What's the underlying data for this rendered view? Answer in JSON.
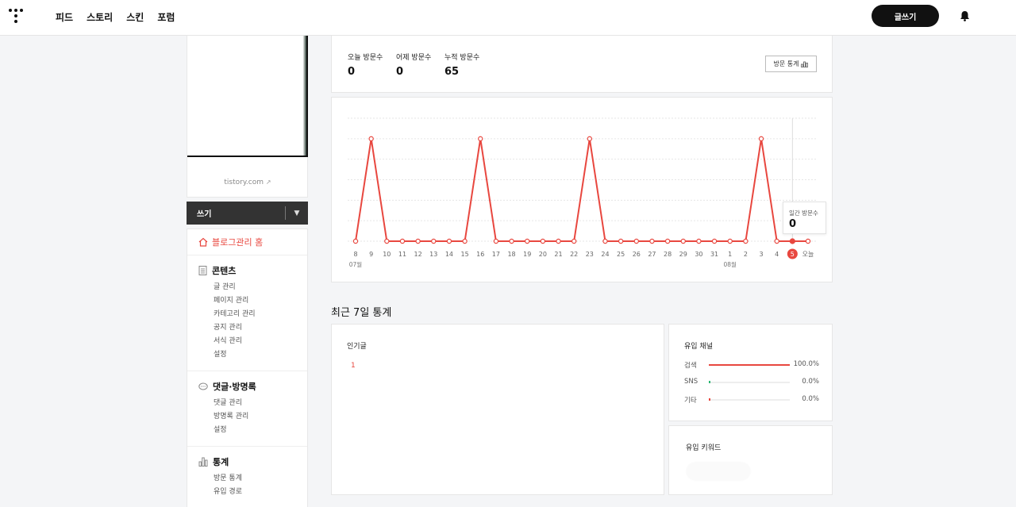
{
  "nav": {
    "items": [
      "피드",
      "스토리",
      "스킨",
      "포럼"
    ],
    "write_button": "글쓰기"
  },
  "sidebar": {
    "blog_url": "tistory.com",
    "write_label": "쓰기",
    "home_label": "블로그관리 홈",
    "groups": [
      {
        "title": "콘텐츠",
        "icon": "document-icon",
        "items": [
          "글 관리",
          "페이지 관리",
          "카테고리 관리",
          "공지 관리",
          "서식 관리",
          "설정"
        ]
      },
      {
        "title": "댓글·방명록",
        "icon": "comment-icon",
        "items": [
          "댓글 관리",
          "방명록 관리",
          "설정"
        ]
      },
      {
        "title": "통계",
        "icon": "bar-chart-icon",
        "items": [
          "방문 통계",
          "유입 경로"
        ]
      }
    ]
  },
  "stats": {
    "today_label": "오늘 방문수",
    "today_value": "0",
    "yesterday_label": "어제 방문수",
    "yesterday_value": "0",
    "total_label": "누적 방문수",
    "total_value": "65",
    "button_label": "방문 통계"
  },
  "chart_data": {
    "type": "line",
    "x": [
      "8",
      "9",
      "10",
      "11",
      "12",
      "13",
      "14",
      "15",
      "16",
      "17",
      "18",
      "19",
      "20",
      "21",
      "22",
      "23",
      "24",
      "25",
      "26",
      "27",
      "28",
      "29",
      "30",
      "31",
      "1",
      "2",
      "3",
      "4",
      "5",
      "오늘"
    ],
    "month_labels": [
      {
        "label": "07월",
        "at": "8"
      },
      {
        "label": "08월",
        "at": "1"
      }
    ],
    "highlight": "5",
    "series": [
      {
        "values": [
          0,
          5,
          0,
          0,
          0,
          0,
          0,
          0,
          5,
          0,
          0,
          0,
          0,
          0,
          0,
          5,
          0,
          0,
          0,
          0,
          0,
          0,
          0,
          0,
          0,
          0,
          5,
          0,
          0,
          0
        ]
      }
    ],
    "ylim": [
      0,
      6
    ],
    "grid": true,
    "color": "#e8473f",
    "tooltip": {
      "label": "일간 방문수",
      "value": "0"
    }
  },
  "recent": {
    "title": "최근 7일 통계",
    "popular_title": "인기글",
    "popular_items": [
      "1"
    ],
    "channel_title": "유입 채널",
    "channels": [
      {
        "name": "검색",
        "pct": "100.0%",
        "value": 100,
        "color": "#e8473f"
      },
      {
        "name": "SNS",
        "pct": "0.0%",
        "value": 0,
        "color": "#2bb673"
      },
      {
        "name": "기타",
        "pct": "0.0%",
        "value": 0,
        "color": "#e8473f"
      }
    ],
    "keyword_title": "유입 키워드"
  }
}
